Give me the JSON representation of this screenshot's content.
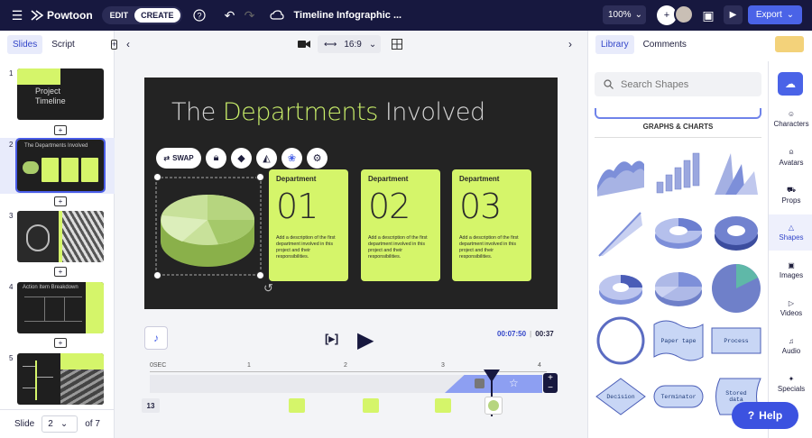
{
  "app": {
    "name": "Powtoon",
    "edit_label": "EDIT",
    "create_label": "CREATE",
    "doc_title": "Timeline Infographic ...",
    "zoom": "100%",
    "export_label": "Export"
  },
  "left": {
    "tabs": [
      "Slides",
      "Script"
    ],
    "slides": [
      "1",
      "2",
      "3",
      "4",
      "5"
    ],
    "thumb_texts": [
      "Project Timeline",
      "The Departments Involved",
      "",
      "Action Item Breakdown",
      ""
    ],
    "nav_label": "Slide",
    "current_slide": "2",
    "total": "of 7"
  },
  "canvas": {
    "ratio": "16:9",
    "title_a": "The ",
    "title_b": "Departments",
    "title_c": " Involved",
    "toolbar_swap": "SWAP",
    "cards": [
      {
        "label": "Department",
        "num": "01",
        "desc": "Add a description of the first department involved in this project and their responsibilities."
      },
      {
        "label": "Department",
        "num": "02",
        "desc": "Add a description of the first department involved in this project and their responsibilities."
      },
      {
        "label": "Department",
        "num": "03",
        "desc": "Add a description of the first department involved in this project and their responsibilities."
      }
    ]
  },
  "timeline": {
    "time_current": "00:07:50",
    "time_total": "00:37",
    "ticks": [
      "0SEC",
      "1",
      "2",
      "3",
      "4"
    ],
    "count": "13"
  },
  "right": {
    "tabs": [
      "Library",
      "Comments"
    ],
    "search_placeholder": "Search Shapes",
    "section_title": "GRAPHS & CHARTS",
    "categories": [
      "Characters",
      "Avatars",
      "Props",
      "Shapes",
      "Images",
      "Videos",
      "Audio",
      "Specials"
    ],
    "flow_shapes": [
      "Paper tape",
      "Process",
      "Decision",
      "Terminator",
      "Stored data"
    ],
    "help_label": "Help"
  },
  "colors": {
    "topbar": "#17183f",
    "accent": "#4a63e7",
    "lime": "#d5f56a",
    "stage": "#232323"
  }
}
